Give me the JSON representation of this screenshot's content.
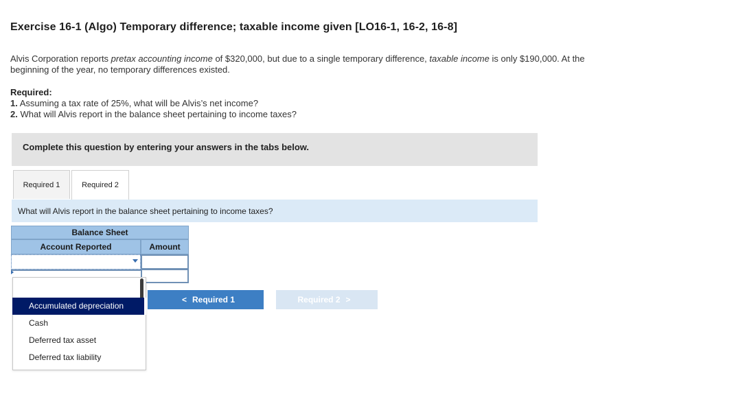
{
  "title": "Exercise 16-1 (Algo) Temporary difference; taxable income given [LO16-1, 16-2, 16-8]",
  "intro": {
    "part1": "Alvis Corporation reports ",
    "em1": "pretax accounting income",
    "part2": " of $320,000, but due to a single temporary difference, ",
    "em2": "taxable income",
    "part3": " is only $190,000. At the beginning of the year, no temporary differences existed."
  },
  "required": {
    "heading": "Required:",
    "items": [
      {
        "num": "1.",
        "text": " Assuming a tax rate of 25%, what will be Alvis’s net income?"
      },
      {
        "num": "2.",
        "text": " What will Alvis report in the balance sheet pertaining to income taxes?"
      }
    ]
  },
  "banner": "Complete this question by entering your answers in the tabs below.",
  "tabs": [
    {
      "label": "Required 1"
    },
    {
      "label": "Required 2"
    }
  ],
  "question": "What will Alvis report in the balance sheet pertaining to income taxes?",
  "table": {
    "title": "Balance Sheet",
    "col_account": "Account Reported",
    "col_amount": "Amount"
  },
  "dropdown": {
    "options": [
      "Accumulated depreciation",
      "Cash",
      "Deferred tax asset",
      "Deferred tax liability"
    ],
    "highlighted_index": 0
  },
  "nav": {
    "prev_label": "Required 1",
    "next_label": "Required 2",
    "prev_chevron": "<",
    "next_chevron": ">"
  },
  "colors": {
    "header_blue": "#9fc3e6",
    "prev_button": "#3d7fc4",
    "next_button_disabled": "#d9e6f3",
    "highlight_option": "#001a66"
  }
}
